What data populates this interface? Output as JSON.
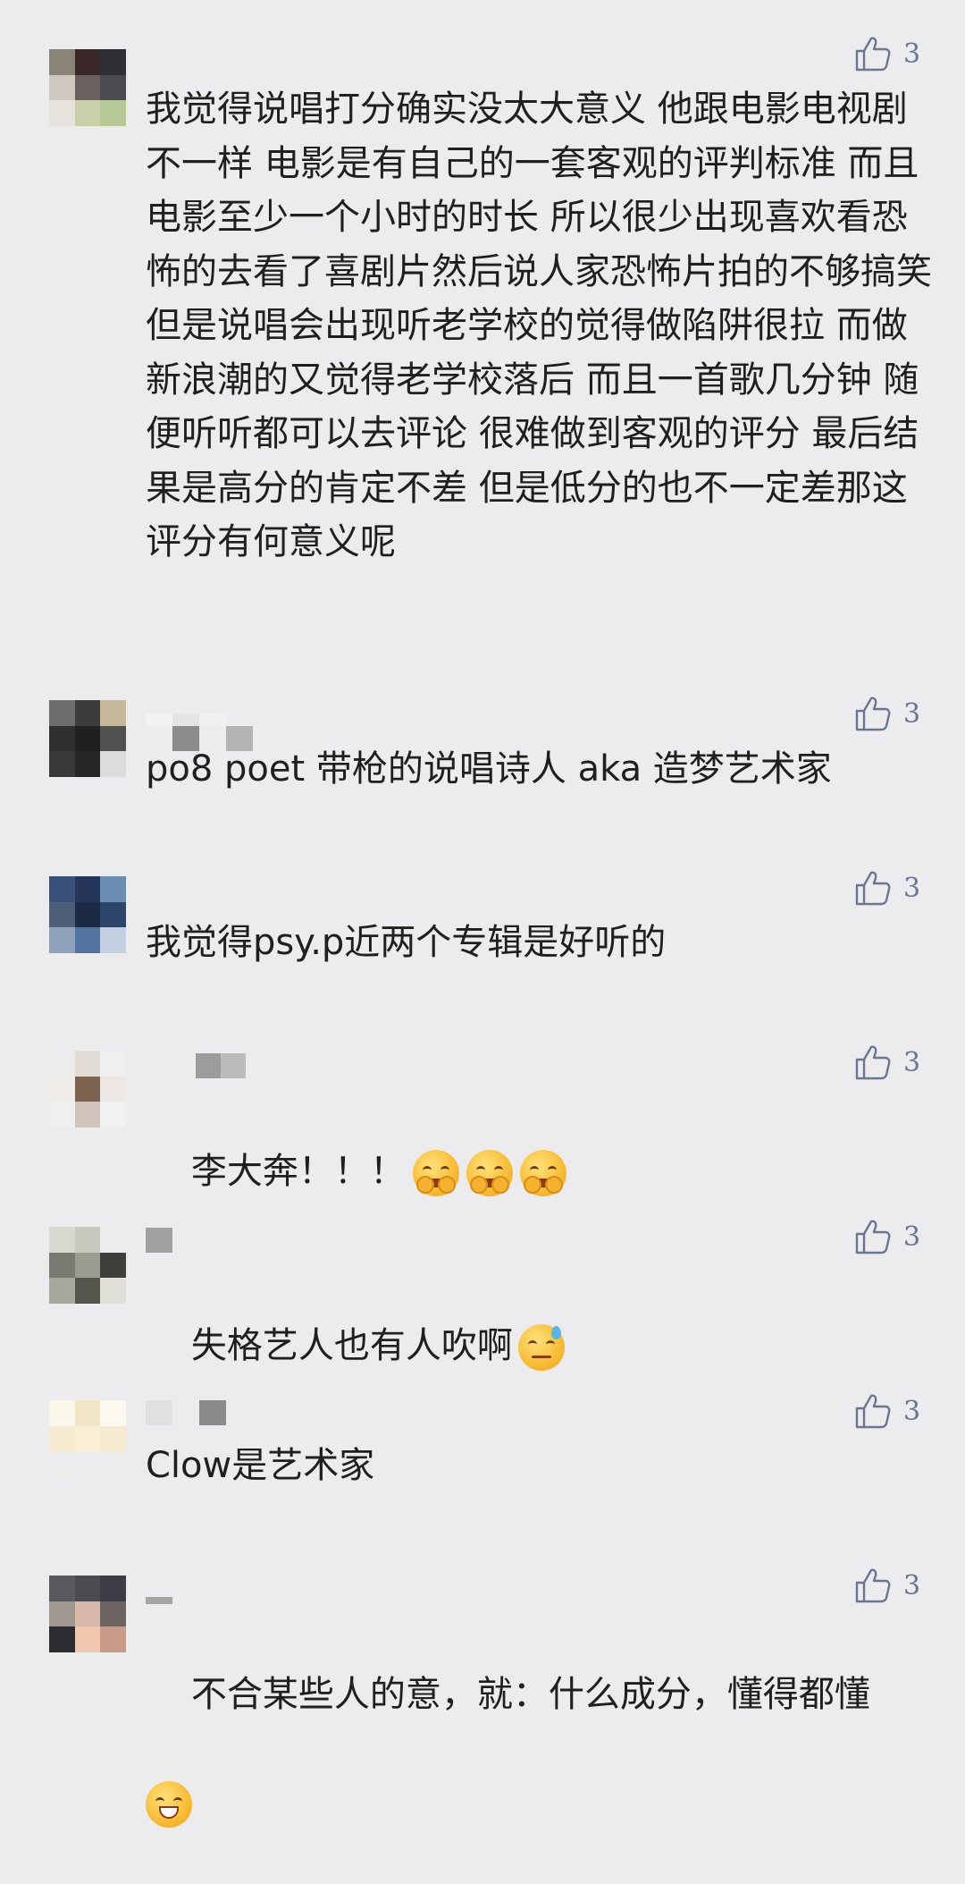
{
  "comments": [
    {
      "like_count": "3",
      "text": "我觉得说唱打分确实没太大意义 他跟电影电视剧不一样 电影是有自己的一套客观的评判标准 而且电影至少一个小时的时长 所以很少出现喜欢看恐怖的去看了喜剧片然后说人家恐怖片拍的不够搞笑 但是说唱会出现听老学校的觉得做陷阱很拉 而做新浪潮的又觉得老学校落后 而且一首歌几分钟 随便听听都可以去评论 很难做到客观的评分 最后结果是高分的肯定不差 但是低分的也不一定差那这评分有何意义呢",
      "emojis": []
    },
    {
      "like_count": "3",
      "text": "po8 poet 带枪的说唱诗人 aka 造梦艺术家",
      "emojis": []
    },
    {
      "like_count": "3",
      "text": "我觉得psy.p近两个专辑是好听的",
      "emojis": []
    },
    {
      "like_count": "3",
      "text": "李大奔！！！",
      "emojis": [
        "hugging-face-emoji",
        "hugging-face-emoji",
        "hugging-face-emoji"
      ]
    },
    {
      "like_count": "3",
      "text": "失格艺人也有人吹啊",
      "emojis": [
        "sweat-face-emoji"
      ]
    },
    {
      "like_count": "3",
      "text": "Clow是艺术家",
      "emojis": []
    },
    {
      "like_count": "3",
      "text": "不合某些人的意，就：什么成分，懂得都懂",
      "emojis": [
        "grinning-face-emoji"
      ]
    }
  ],
  "icons": {
    "like": "thumbs-up-icon"
  },
  "colors": {
    "background": "#ececee",
    "like_icon": "#6a7590",
    "text": "#1f1f1f"
  }
}
